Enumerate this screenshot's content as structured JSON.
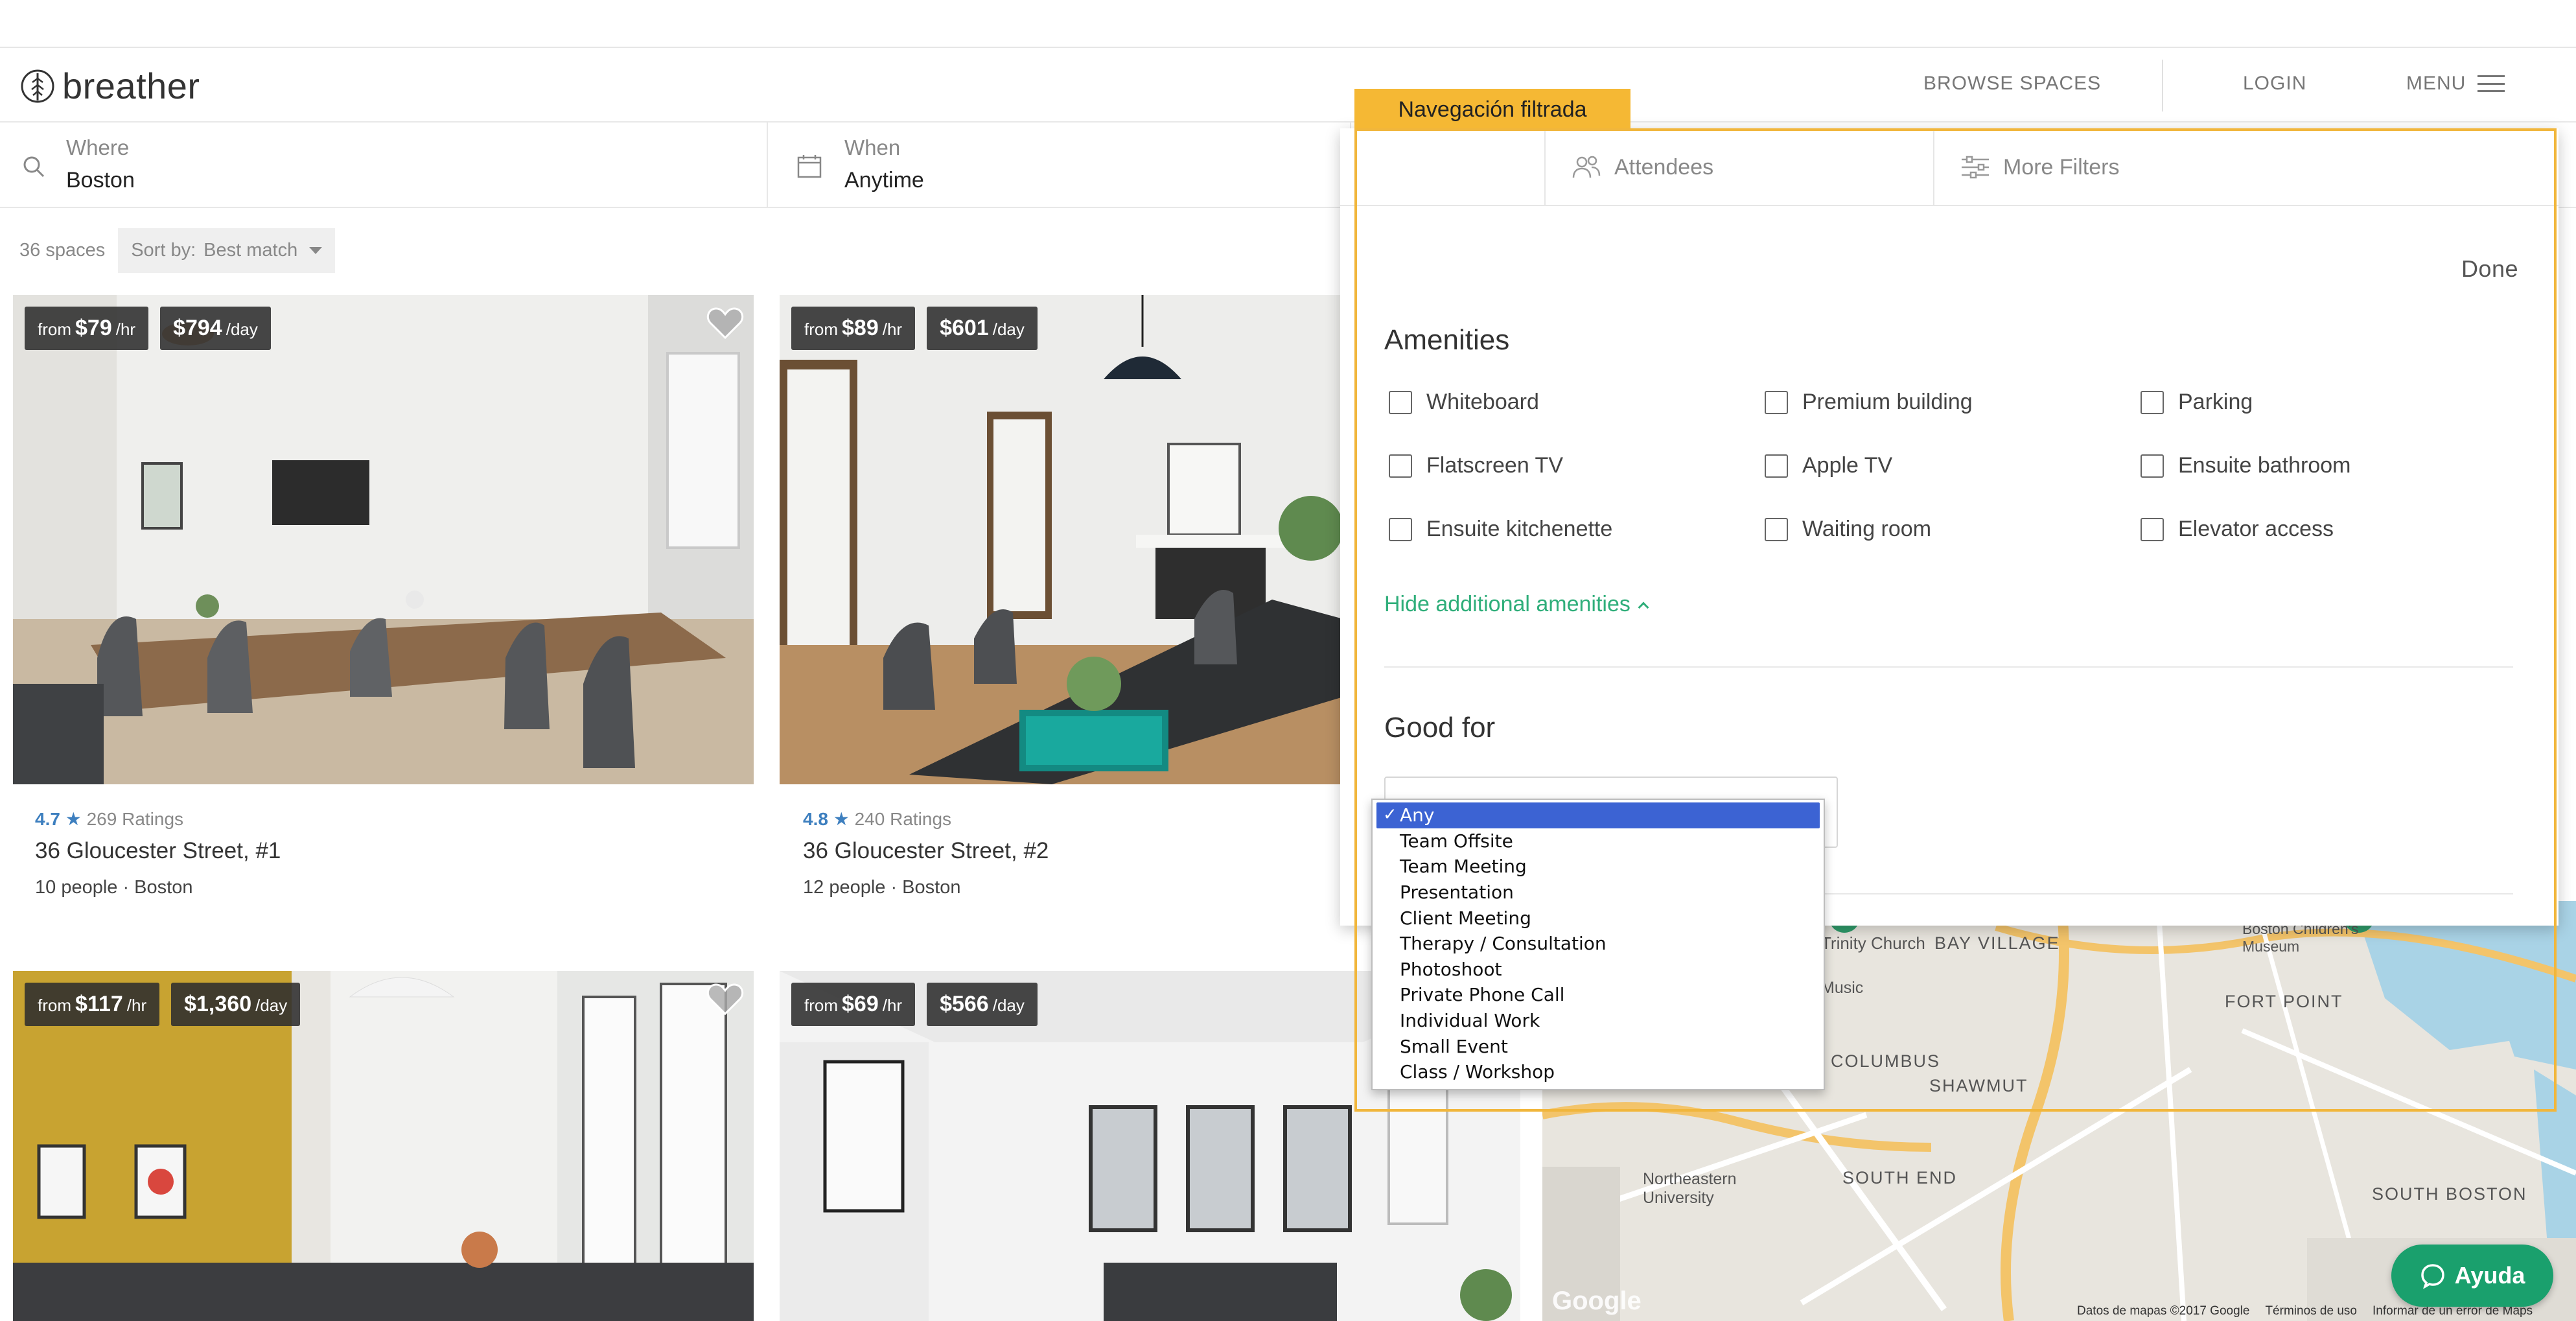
{
  "brand": {
    "name": "breather"
  },
  "nav": {
    "browse": "BROWSE SPACES",
    "login": "LOGIN",
    "menu": "MENU"
  },
  "search": {
    "where_label": "Where",
    "where_value": "Boston",
    "when_label": "When",
    "when_value": "Anytime"
  },
  "results": {
    "count": "36 spaces",
    "sort_label": "Sort by:",
    "sort_value": "Best match"
  },
  "listings": [
    {
      "from": "from",
      "hourly": "$79",
      "hr_unit": "/hr",
      "daily": "$794",
      "day_unit": "/day",
      "rating": "4.7",
      "ratings_count": "269 Ratings",
      "title": "36 Gloucester Street, #1",
      "meta": "10 people · Boston"
    },
    {
      "from": "from",
      "hourly": "$89",
      "hr_unit": "/hr",
      "daily": "$601",
      "day_unit": "/day",
      "rating": "4.8",
      "ratings_count": "240 Ratings",
      "title": "36 Gloucester Street, #2",
      "meta": "12 people · Boston"
    },
    {
      "from": "from",
      "hourly": "$117",
      "hr_unit": "/hr",
      "daily": "$1,360",
      "day_unit": "/day"
    },
    {
      "from": "from",
      "hourly": "$69",
      "hr_unit": "/hr",
      "daily": "$566",
      "day_unit": "/day"
    }
  ],
  "filters": {
    "tabs": {
      "attendees": "Attendees",
      "more_filters": "More Filters"
    },
    "done": "Done",
    "amenities_title": "Amenities",
    "amenities": [
      "Whiteboard",
      "Premium building",
      "Parking",
      "Flatscreen TV",
      "Apple TV",
      "Ensuite bathroom",
      "Ensuite kitchenette",
      "Waiting room",
      "Elevator access"
    ],
    "hide_amenities": "Hide additional amenities",
    "good_for_title": "Good for",
    "good_for_options": [
      "Any",
      "Team Offsite",
      "Team Meeting",
      "Presentation",
      "Client Meeting",
      "Therapy / Consultation",
      "Photoshoot",
      "Private Phone Call",
      "Individual Work",
      "Small Event",
      "Class / Workshop"
    ],
    "good_for_selected": "Any"
  },
  "callout": {
    "label": "Navegación filtrada",
    "color": "#f5b834"
  },
  "map": {
    "labels": [
      "Trinity Church",
      "BAY VILLAGE",
      "FORT POINT",
      "COLUMBUS",
      "SHAWMUT",
      "SOUTH END",
      "SOUTH BOSTON",
      "Northeastern University",
      "Boston Children's Museum",
      "Music"
    ],
    "google": "Google",
    "credit": [
      "Datos de mapas ©2017 Google",
      "Términos de uso",
      "Informar de un error de Maps"
    ]
  },
  "help": {
    "label": "Ayuda",
    "color": "#1aa06d"
  },
  "icons": [
    "breather-logo-icon",
    "search-icon",
    "calendar-icon",
    "attendees-icon",
    "sliders-icon",
    "heart-icon",
    "chat-icon",
    "hamburger-icon"
  ]
}
